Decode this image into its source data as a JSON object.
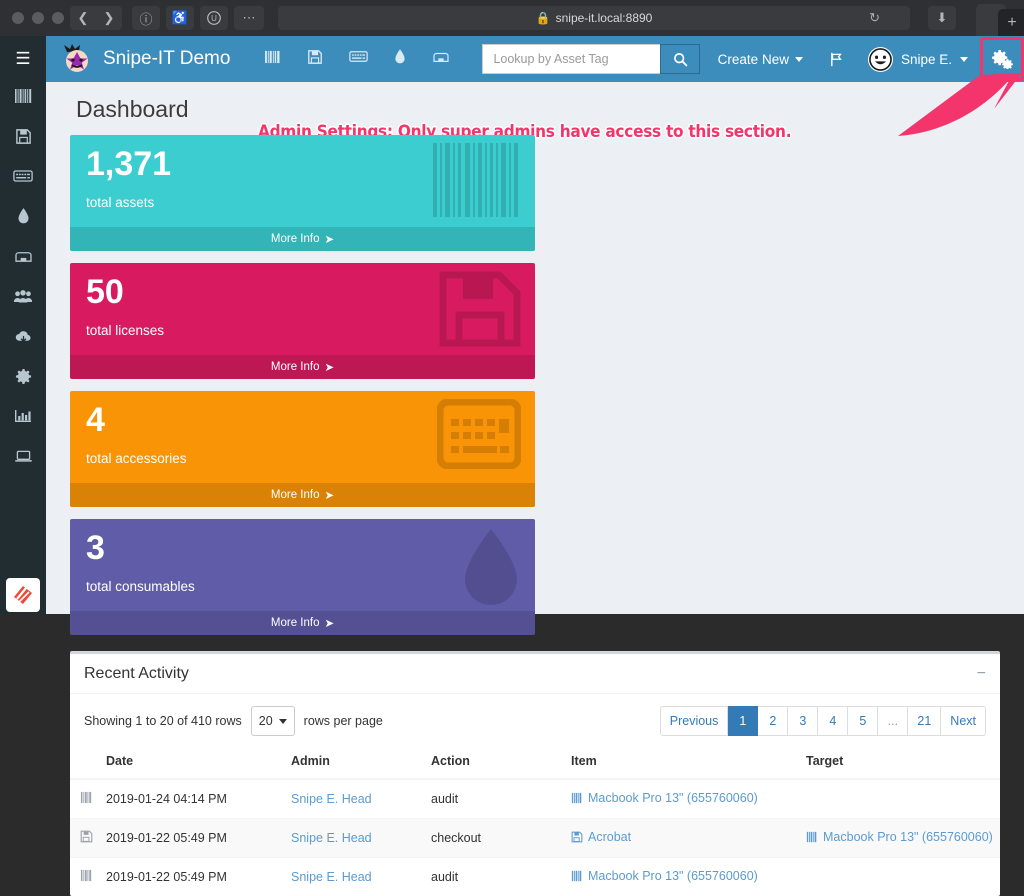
{
  "browser": {
    "url": "snipe-it.local:8890",
    "lock_icon": "lock-icon",
    "reload_icon": "reload-icon",
    "back_icon": "back-chevron-icon",
    "forward_icon": "forward-chevron-icon",
    "info_icon": "info-circle-icon",
    "accessibility_icon": "accessibility-icon",
    "user_icon": "user-circle-icon",
    "more_icon": "more-dots-icon",
    "download_icon": "download-icon",
    "new_tab_label": "+"
  },
  "header": {
    "menu_icon": "hamburger-menu-icon",
    "brand": "Snipe-IT Demo",
    "nav_icons": [
      "barcode-icon",
      "floppy-disk-icon",
      "keyboard-icon",
      "droplet-icon",
      "printer-icon"
    ],
    "search": {
      "placeholder": "Lookup by Asset Tag",
      "value": "",
      "button_icon": "search-icon"
    },
    "create_new": "Create New",
    "flag_icon": "flag-icon",
    "avatar_icon": "smiley-avatar-icon",
    "user_name": "Snipe E.",
    "settings_icon": "gears-settings-icon",
    "accent_color": "#3c8dbc",
    "highlight_color": "#f4356b"
  },
  "sidebar": {
    "items": [
      {
        "icon": "dashboard-speedometer-icon",
        "name": "dashboard",
        "active": true
      },
      {
        "icon": "barcode-icon",
        "name": "assets",
        "active": false
      },
      {
        "icon": "floppy-disk-icon",
        "name": "licenses",
        "active": false
      },
      {
        "icon": "keyboard-icon",
        "name": "accessories",
        "active": false
      },
      {
        "icon": "droplet-icon",
        "name": "consumables",
        "active": false
      },
      {
        "icon": "printer-icon",
        "name": "components",
        "active": false
      },
      {
        "icon": "people-icon",
        "name": "people",
        "active": false
      },
      {
        "icon": "cloud-download-icon",
        "name": "import",
        "active": false
      },
      {
        "icon": "gear-icon",
        "name": "settings",
        "active": false
      },
      {
        "icon": "bar-chart-icon",
        "name": "reports",
        "active": false
      },
      {
        "icon": "laptop-icon",
        "name": "requestable",
        "active": false
      }
    ],
    "app_badge_icon": "snipe-it-app-icon"
  },
  "annotation": {
    "text": "Admin Settings: Only super admins have access to this section.",
    "color": "#f4356b"
  },
  "main": {
    "page_title": "Dashboard",
    "cards": [
      {
        "value": "1,371",
        "label": "total assets",
        "more": "More Info",
        "color": "#3bcdd0",
        "bg_icon": "barcode-icon"
      },
      {
        "value": "50",
        "label": "total licenses",
        "more": "More Info",
        "color": "#d81b60",
        "bg_icon": "floppy-disk-icon"
      },
      {
        "value": "4",
        "label": "total accessories",
        "more": "More Info",
        "color": "#f89406",
        "bg_icon": "keyboard-icon"
      },
      {
        "value": "3",
        "label": "total consumables",
        "more": "More Info",
        "color": "#605ca8",
        "bg_icon": "droplet-icon"
      }
    ],
    "activity": {
      "title": "Recent Activity",
      "collapse_icon": "minus-icon",
      "showing_text": "Showing 1 to 20 of 410 rows",
      "rows_per_page_value": "20",
      "rows_per_page_label": "rows per page",
      "pagination": [
        {
          "label": "Previous",
          "active": false,
          "muted": false
        },
        {
          "label": "1",
          "active": true,
          "muted": false
        },
        {
          "label": "2",
          "active": false,
          "muted": false
        },
        {
          "label": "3",
          "active": false,
          "muted": false
        },
        {
          "label": "4",
          "active": false,
          "muted": false
        },
        {
          "label": "5",
          "active": false,
          "muted": false
        },
        {
          "label": "...",
          "active": false,
          "muted": true
        },
        {
          "label": "21",
          "active": false,
          "muted": false
        },
        {
          "label": "Next",
          "active": false,
          "muted": false
        }
      ],
      "columns": [
        "Date",
        "Admin",
        "Action",
        "Item",
        "Target"
      ],
      "rows": [
        {
          "row_icon": "barcode-icon",
          "date": "2019-01-24 04:14 PM",
          "admin": "Snipe E. Head",
          "action": "audit",
          "item": "Macbook Pro 13\" (655760060)",
          "item_icon": "barcode-icon",
          "target": "",
          "target_icon": ""
        },
        {
          "row_icon": "floppy-disk-icon",
          "date": "2019-01-22 05:49 PM",
          "admin": "Snipe E. Head",
          "action": "checkout",
          "item": "Acrobat",
          "item_icon": "floppy-disk-icon",
          "target": "Macbook Pro 13\" (655760060)",
          "target_icon": "barcode-icon"
        },
        {
          "row_icon": "barcode-icon",
          "date": "2019-01-22 05:49 PM",
          "admin": "Snipe E. Head",
          "action": "audit",
          "item": "Macbook Pro 13\" (655760060)",
          "item_icon": "barcode-icon",
          "target": "",
          "target_icon": ""
        }
      ]
    }
  }
}
